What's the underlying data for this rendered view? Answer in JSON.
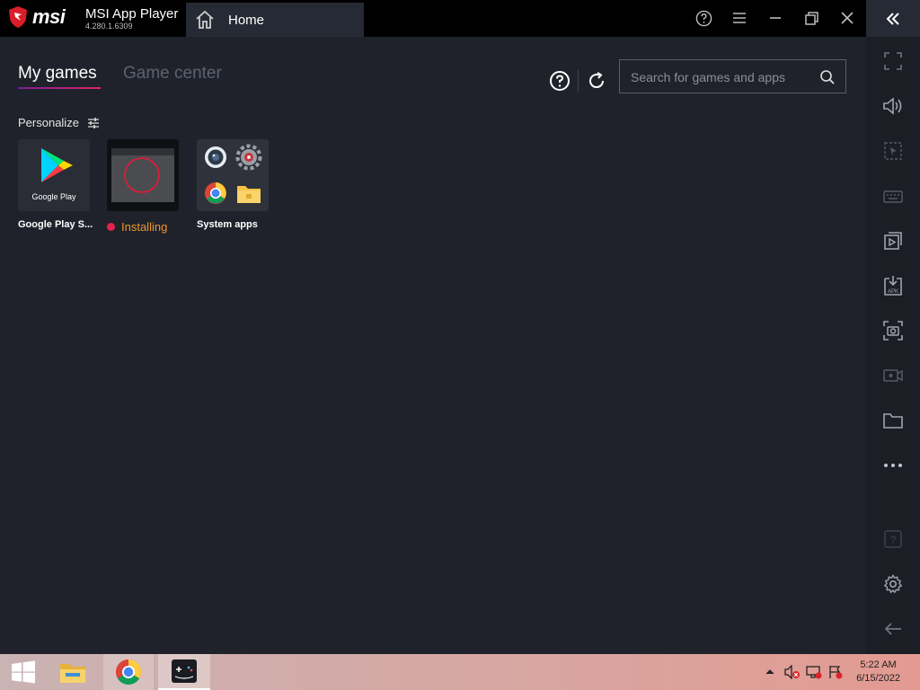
{
  "window": {
    "brand": "msi",
    "app_title": "MSI App Player",
    "app_version": "4.280.1.6309",
    "home_tab": "Home"
  },
  "tabs": {
    "my_games": "My games",
    "game_center": "Game center"
  },
  "search": {
    "placeholder": "Search for games and apps"
  },
  "personalize": {
    "label": "Personalize"
  },
  "apps": [
    {
      "label": "Google Play S...",
      "icon_caption": "Google Play"
    },
    {
      "label": "",
      "status": "Installing"
    },
    {
      "label": "System apps"
    }
  ],
  "taskbar": {
    "time": "5:22 AM",
    "date": "6/15/2022"
  },
  "colors": {
    "accent": "#e0245e",
    "installing": "#f0962a",
    "status_dot": "#e0244b"
  }
}
